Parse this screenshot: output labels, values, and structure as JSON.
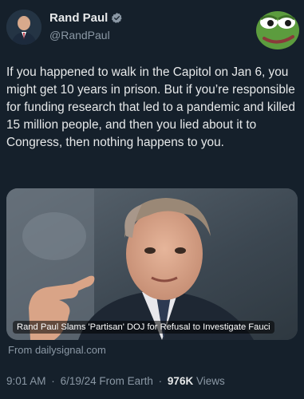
{
  "author": {
    "display_name": "Rand Paul",
    "handle": "@RandPaul",
    "verified_icon": "verified-badge-icon"
  },
  "tweet": {
    "text": "If you happened to walk in the Capitol on Jan 6, you might get 10 years in prison. But if you’re responsible for funding research that led to a pandemic and killed 15 million people, and then you lied about it to Congress, then nothing happens to you."
  },
  "link_card": {
    "headline": "Rand Paul Slams 'Partisan' DOJ for Refusal to Investigate Fauci",
    "source": "From dailysignal.com"
  },
  "meta": {
    "time": "9:01 AM",
    "date": "6/19/24",
    "client": "From Earth",
    "separator": "·",
    "views_count": "976K",
    "views_label": "Views"
  },
  "colors": {
    "background": "#15202b",
    "text_primary": "#e7e9ea",
    "text_secondary": "#8b98a5",
    "verified": "#1d9bf0"
  }
}
